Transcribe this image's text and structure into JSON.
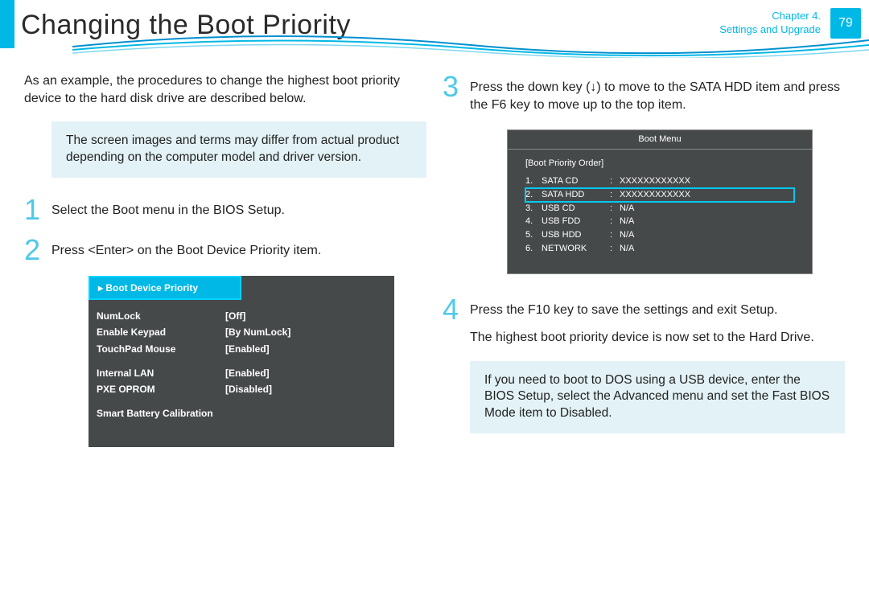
{
  "header": {
    "title": "Changing the Boot Priority",
    "chapter_line1": "Chapter 4.",
    "chapter_line2": "Settings and Upgrade",
    "page_number": "79"
  },
  "left": {
    "intro": "As an example, the procedures to change the highest boot priority device to the hard disk drive are described below.",
    "note": "The screen images and terms may differ from actual product depending on the computer model and driver version.",
    "step1_num": "1",
    "step1_text": "Select the Boot menu in the BIOS Setup.",
    "step2_num": "2",
    "step2_text": "Press <Enter> on the Boot Device Priority item.",
    "bios1": {
      "header": "▸ Boot Device Priority",
      "rows": [
        {
          "k": "NumLock",
          "v": "[Off]"
        },
        {
          "k": "Enable Keypad",
          "v": "[By NumLock]"
        },
        {
          "k": "TouchPad Mouse",
          "v": "[Enabled]"
        }
      ],
      "rows2": [
        {
          "k": "Internal LAN",
          "v": "[Enabled]"
        },
        {
          "k": "PXE OPROM",
          "v": "[Disabled]"
        }
      ],
      "smart": "Smart Battery Calibration"
    }
  },
  "right": {
    "step3_num": "3",
    "step3_text": "Press the down key (↓) to move to the SATA HDD item and press the F6 key to move up to the top item.",
    "bios2": {
      "title": "Boot Menu",
      "subtitle": "[Boot Priority Order]",
      "items": [
        {
          "n": "1.",
          "k": "SATA CD",
          "v": "XXXXXXXXXXXX",
          "hl": false
        },
        {
          "n": "2.",
          "k": "SATA HDD",
          "v": "XXXXXXXXXXXX",
          "hl": true
        },
        {
          "n": "3.",
          "k": "USB CD",
          "v": "N/A",
          "hl": false
        },
        {
          "n": "4.",
          "k": "USB FDD",
          "v": "N/A",
          "hl": false
        },
        {
          "n": "5.",
          "k": "USB HDD",
          "v": "N/A",
          "hl": false
        },
        {
          "n": "6.",
          "k": "NETWORK",
          "v": "N/A",
          "hl": false
        }
      ]
    },
    "step4_num": "4",
    "step4_text": "Press the F10 key to save the settings and exit Setup.",
    "result": "The highest boot priority device is now set to the Hard Drive.",
    "note": "If you need to boot to DOS using a USB device, enter the BIOS Setup, select the Advanced menu and set the Fast BIOS Mode item to Disabled."
  }
}
